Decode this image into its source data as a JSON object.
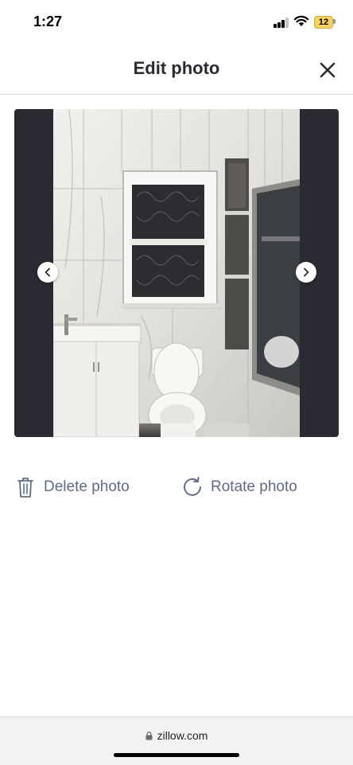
{
  "status": {
    "time": "1:27",
    "battery": "12",
    "icons": [
      "signal-icon",
      "wifi-icon",
      "battery-icon"
    ]
  },
  "header": {
    "title": "Edit photo",
    "close_icon": "close-icon"
  },
  "photo": {
    "nav_prev_icon": "chevron-left-icon",
    "nav_next_icon": "chevron-right-icon"
  },
  "actions": [
    {
      "label": "Delete photo",
      "icon": "trash-icon"
    },
    {
      "label": "Rotate photo",
      "icon": "rotate-icon"
    }
  ],
  "browser": {
    "url": "zillow.com",
    "lock_icon": "lock-icon"
  },
  "colors": {
    "text": "#2a2a33",
    "action": "#5e6b85",
    "frame": "#2a2a33",
    "battery": "#f4d35e"
  }
}
